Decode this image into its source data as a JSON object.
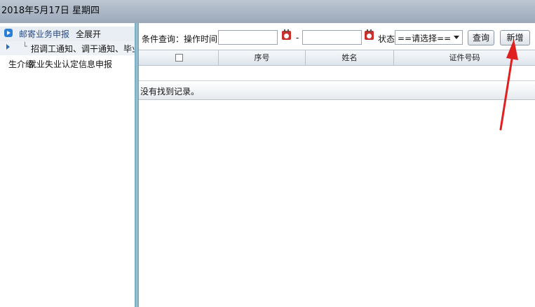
{
  "header": {
    "date_text": "2018年5月17日 星期四"
  },
  "sidebar": {
    "root_label": "邮寄业务申报",
    "expand_all": "全展开",
    "branch_glyph": "└",
    "child_label": "招调工通知、调干通知、毕业",
    "item2_prefix": "生介绍",
    "item2_label": "就业失业认定信息申报"
  },
  "toolbar": {
    "condition_label": "条件查询：操作时间",
    "start_time_value": "",
    "range_dash": "-",
    "end_time_value": "",
    "status_label": "状态",
    "status_selected": "==请选择==",
    "query_button": "查询",
    "add_button": "新增"
  },
  "grid": {
    "columns": [
      "序号",
      "姓名",
      "证件号码"
    ],
    "empty_message": "没有找到记录。"
  },
  "colors": {
    "header_bg": "#a9b5c4",
    "splitter": "#7fb0c2",
    "arrow_annotation": "#e02020",
    "calendar_icon": "#c9302c"
  }
}
